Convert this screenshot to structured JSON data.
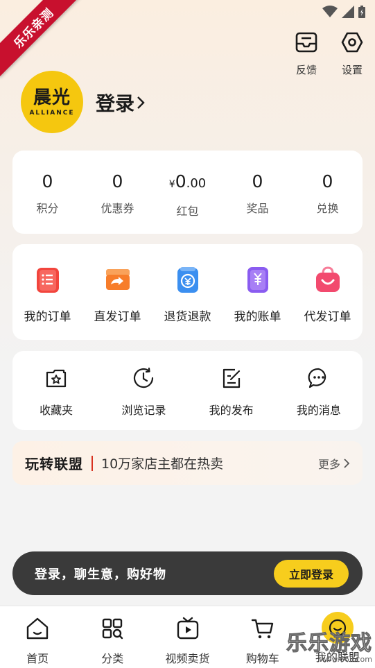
{
  "status_bar": {
    "signal_icon": "wifi-icon",
    "cell_icon": "cell-signal-icon",
    "battery_icon": "battery-icon"
  },
  "ribbon": {
    "text": "乐乐亲测"
  },
  "header": {
    "feedback_label": "反馈",
    "settings_label": "设置"
  },
  "profile": {
    "avatar_text": "晨光",
    "avatar_sub": "ALLIANCE",
    "login_label": "登录"
  },
  "stats": [
    {
      "value": "0",
      "label": "积分"
    },
    {
      "value": "0",
      "label": "优惠券"
    },
    {
      "currency": "¥",
      "int": "0",
      "dec": ".00",
      "label": "红包"
    },
    {
      "value": "0",
      "label": "奖品"
    },
    {
      "value": "0",
      "label": "兑换"
    }
  ],
  "orders": [
    {
      "label": "我的订单",
      "icon": "order-list-icon",
      "color": "#f2453d"
    },
    {
      "label": "直发订单",
      "icon": "direct-ship-icon",
      "color": "#f77d2a"
    },
    {
      "label": "退货退款",
      "icon": "refund-icon",
      "color": "#3b8ff0"
    },
    {
      "label": "我的账单",
      "icon": "bill-icon",
      "color": "#8a5cf0"
    },
    {
      "label": "代发订单",
      "icon": "proxy-order-icon",
      "color": "#f24a6e"
    }
  ],
  "tools": [
    {
      "label": "收藏夹",
      "icon": "favorites-icon"
    },
    {
      "label": "浏览记录",
      "icon": "history-icon"
    },
    {
      "label": "我的发布",
      "icon": "publish-icon"
    },
    {
      "label": "我的消息",
      "icon": "message-icon"
    }
  ],
  "promo": {
    "brand": "玩转联盟",
    "slogan": "10万家店主都在热卖",
    "more_label": "更多"
  },
  "login_bar": {
    "message": "登录，聊生意，购好物",
    "button_label": "立即登录"
  },
  "tabs": [
    {
      "label": "首页",
      "icon": "home-icon"
    },
    {
      "label": "分类",
      "icon": "category-icon"
    },
    {
      "label": "视频卖货",
      "icon": "video-icon"
    },
    {
      "label": "购物车",
      "icon": "cart-icon"
    },
    {
      "label": "我的联盟",
      "icon": "smile-icon"
    }
  ],
  "watermark": {
    "title": "乐乐游戏",
    "url": "www.66ll.com"
  },
  "colors": {
    "accent": "#f7cd1d",
    "dark_bar": "#3a3a3a",
    "ribbon": "#c8102e"
  }
}
